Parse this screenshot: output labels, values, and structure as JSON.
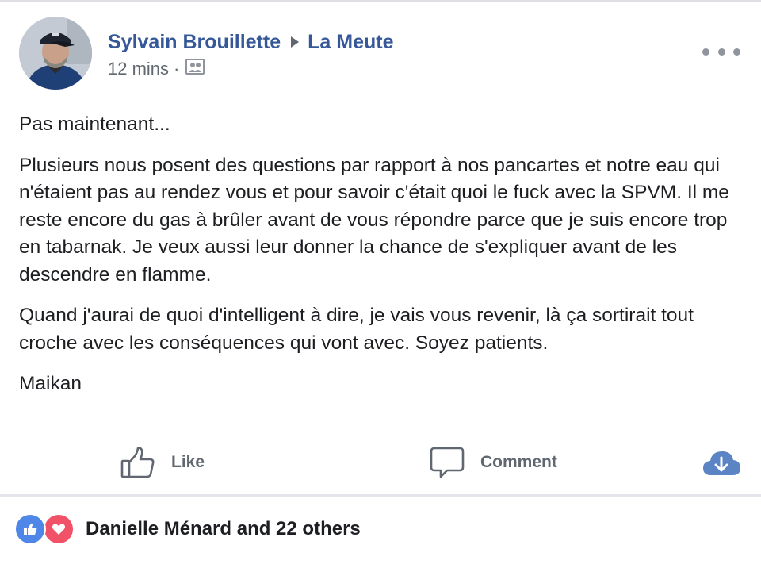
{
  "post": {
    "author": "Sylvain Brouillette",
    "group": "La Meute",
    "timestamp": "12 mins",
    "meta_separator": "·",
    "privacy_icon": "group-audience-icon",
    "paragraphs": [
      "Pas maintenant...",
      "Plusieurs nous posent des questions par rapport à nos pancartes et notre eau qui n'étaient pas au rendez vous et pour savoir c'était quoi le fuck avec la SPVM. Il me reste encore du gas à brûler avant de vous répondre parce que je suis encore trop en tabarnak. Je veux aussi leur donner la chance de s'expliquer avant de les descendre en flamme.",
      "Quand j'aurai de quoi d'intelligent à dire, je vais vous revenir, là ça sortirait tout croche avec les conséquences qui vont avec. Soyez patients.",
      "Maikan"
    ]
  },
  "actions": {
    "like_label": "Like",
    "comment_label": "Comment",
    "download_icon": "cloud-download-icon"
  },
  "reactions": {
    "summary": "Danielle Ménard and 22 others",
    "types": [
      "like-reaction-icon",
      "love-reaction-icon"
    ]
  },
  "colors": {
    "link_blue": "#365899",
    "like_blue": "#4f87e8",
    "love_red": "#f25268",
    "action_gray": "#606770",
    "download_blue": "#5b84c4"
  }
}
